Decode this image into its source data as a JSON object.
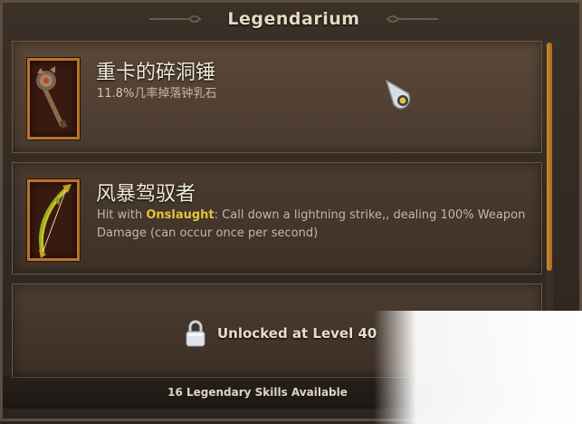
{
  "header": {
    "title": "Legendarium"
  },
  "items": [
    {
      "name": "重卡的碎洞锤",
      "desc_pct": "11.8%",
      "desc_rest": "几率掉落钟乳石",
      "icon": "hammer-icon"
    },
    {
      "name": "风暴驾驭者",
      "desc_prefix": "Hit with ",
      "desc_highlight": "Onslaught",
      "desc_suffix": ": Call down a lightning strike,, dealing 100% Weapon Damage (can occur once per second)",
      "icon": "bow-icon"
    },
    {
      "locked_label": "Unlocked at Level 40",
      "icon": "padlock-icon"
    }
  ],
  "footer": {
    "text": "16 Legendary Skills Available"
  },
  "colors": {
    "highlight": "#e8c33a",
    "frame": "#b8742b",
    "scroll_thumb": "#c98a33"
  }
}
